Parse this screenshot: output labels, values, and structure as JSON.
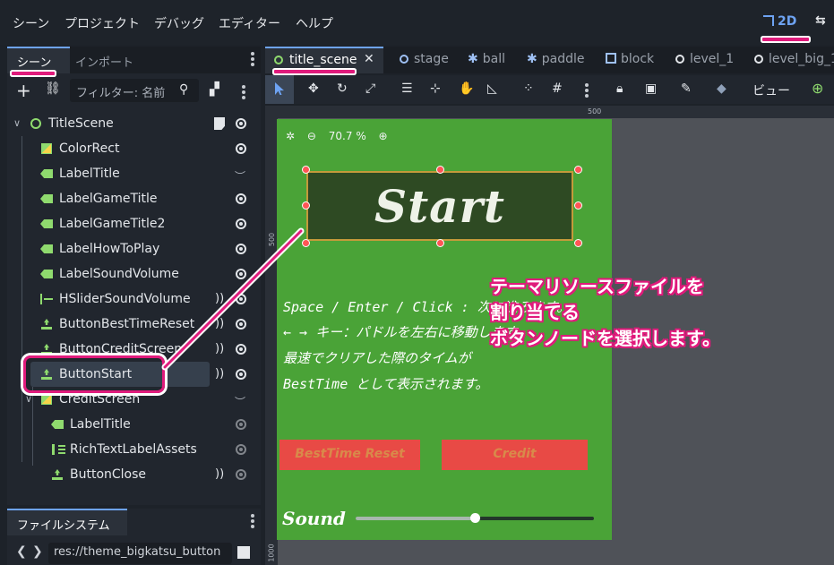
{
  "menu": {
    "items": [
      "シーン",
      "プロジェクト",
      "デバッグ",
      "エディター",
      "ヘルプ"
    ],
    "mode_2d": "2D"
  },
  "scene_dock": {
    "tabs": [
      "シーン",
      "インポート"
    ],
    "filter_placeholder": "フィルター: 名前",
    "nodes": [
      {
        "name": "TitleScene",
        "type": "root"
      },
      {
        "name": "ColorRect",
        "type": "colorrect"
      },
      {
        "name": "LabelTitle",
        "type": "label"
      },
      {
        "name": "LabelGameTitle",
        "type": "label"
      },
      {
        "name": "LabelGameTitle2",
        "type": "label"
      },
      {
        "name": "LabelHowToPlay",
        "type": "label"
      },
      {
        "name": "LabelSoundVolume",
        "type": "label"
      },
      {
        "name": "HSliderSoundVolume",
        "type": "slider"
      },
      {
        "name": "ButtonBestTimeReset",
        "type": "button"
      },
      {
        "name": "ButtonCreditScreen",
        "type": "button"
      },
      {
        "name": "ButtonStart",
        "type": "button",
        "selected": true
      },
      {
        "name": "CreditScreen",
        "type": "colorrect"
      },
      {
        "name": "LabelTitle",
        "type": "label"
      },
      {
        "name": "RichTextLabelAssets",
        "type": "richtext"
      },
      {
        "name": "ButtonClose",
        "type": "button"
      }
    ]
  },
  "file_system": {
    "tab": "ファイルシステム",
    "path": "res://theme_bigkatsu_button"
  },
  "editor_tabs": [
    "title_scene",
    "stage",
    "ball",
    "paddle",
    "block",
    "level_1",
    "level_big_1"
  ],
  "editor_toolbar": {
    "view_label": "ビュー"
  },
  "rulers": {
    "top_500": "500",
    "left_500": "500",
    "left_1000": "1000"
  },
  "viewport": {
    "zoom": "70.7 %",
    "start_button_label": "Start",
    "instructions": [
      "Space / Enter / Click : 次に進みます。",
      "← → キー：パドルを左右に移動します。",
      "最速でクリアした際のタイムが",
      "BestTime として表示されます。"
    ],
    "best_time_reset_label": "BestTime Reset",
    "credit_label": "Credit",
    "sound_label": "Sound",
    "sound_volume": 0.5
  },
  "annotation": {
    "lines": [
      "テーマリソースファイルを",
      "割り当てる",
      "ボタンノードを選択します。"
    ],
    "color": "#e01b7c"
  }
}
